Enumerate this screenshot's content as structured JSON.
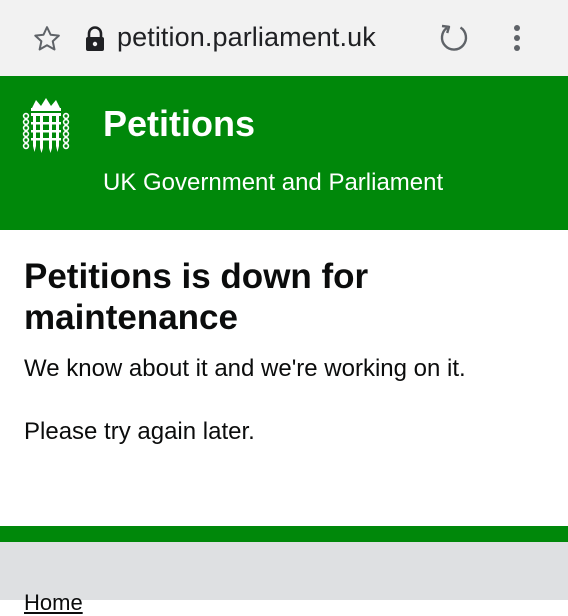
{
  "browser": {
    "url": "petition.parliament.uk"
  },
  "header": {
    "title": "Petitions",
    "subtitle": "UK Government and Parliament"
  },
  "main": {
    "heading": "Petitions is down for maintenance",
    "paragraph_1": "We know about it and we're working on it.",
    "paragraph_2": "Please try again later."
  },
  "footer": {
    "home_link": "Home"
  },
  "colors": {
    "header_green": "#00880a",
    "footer_grey": "#dee0e2"
  }
}
